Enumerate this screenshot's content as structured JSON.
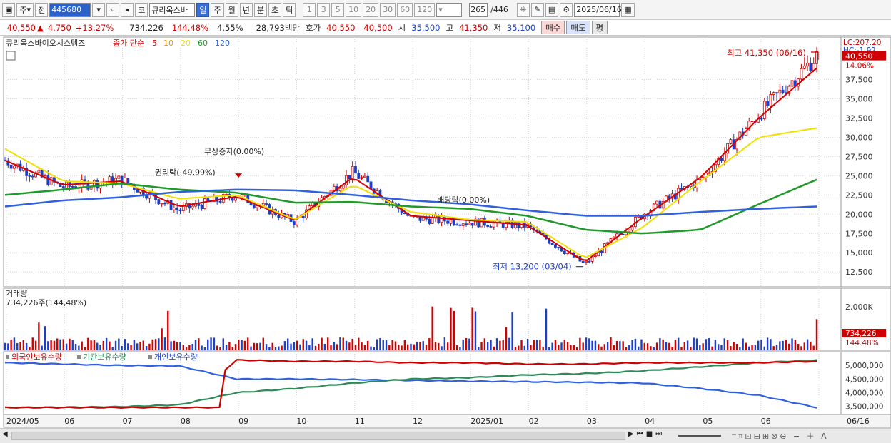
{
  "toolbar": {
    "period_selector": "주",
    "prev_label": "전",
    "stock_code": "445680",
    "code_label": "코",
    "stock_name": "큐리옥스바",
    "active_period": "일",
    "periods": [
      "주",
      "월",
      "년",
      "분",
      "초",
      "틱"
    ],
    "intervals": [
      "1",
      "3",
      "5",
      "10",
      "20",
      "30",
      "60",
      "120"
    ],
    "count_display": "265",
    "count_total": "/446",
    "date": "2025/06/16"
  },
  "quote": {
    "price": "40,550",
    "change_arrow": "▲",
    "change": "4,750",
    "change_pct": "+13.27%",
    "volume": "734,226",
    "volume_ratio": "144.48%",
    "turnover_rate": "4.55%",
    "amount": "28,793백만",
    "ask_label": "호가",
    "ask": "40,550",
    "bid": "40,500",
    "open_label": "시",
    "open": "35,500",
    "high_label": "고",
    "high": "41,350",
    "low_label": "저",
    "low": "35,100",
    "buy_label": "매수",
    "sell_label": "매도",
    "eval_label": "평"
  },
  "price_panel": {
    "stock_label": "큐리옥스바이오시스템즈",
    "indicator_label": "종가 단순",
    "ma_periods": [
      "5",
      "10",
      "20",
      "60",
      "120"
    ],
    "ma_colors": [
      "#d40000",
      "#f08c00",
      "#f0e000",
      "#1e9a2a",
      "#3060e0"
    ],
    "lc_label": "LC:207.20",
    "hc_label": "HC:-1.92",
    "last_price_tag": "40,550",
    "last_pct_tag": "14.06%",
    "y_ticks": [
      "37,500",
      "35,000",
      "32,500",
      "30,000",
      "27,500",
      "25,000",
      "22,500",
      "20,000",
      "17,500",
      "15,000",
      "12,500"
    ],
    "annotations": {
      "high": "최고 41,350 (06/16)",
      "low": "최저 13,200 (03/04)",
      "rights": "권리락(-49,99%)",
      "bonus": "무상증자(0.00%)",
      "dividend": "배당락(0.00%)"
    }
  },
  "volume_panel": {
    "title": "거래량",
    "value_text": "734,226주(144,48%)",
    "y_tick": "2,000K",
    "last_tag": "734,226",
    "last_pct_tag": "144.48%"
  },
  "holding_panel": {
    "series_labels": [
      "외국인보유수량",
      "기관보유수량",
      "개인보유수량"
    ],
    "series_colors": [
      "#1d3fc6",
      "#2e8b57",
      "#d10000"
    ],
    "y_ticks": [
      "5,000,000",
      "4,500,000",
      "4,000,000",
      "3,500,000"
    ]
  },
  "x_axis": {
    "labels": [
      "2024/05",
      "06",
      "07",
      "08",
      "09",
      "10",
      "11",
      "12",
      "2025/01",
      "02",
      "03",
      "04",
      "05",
      "06",
      "06/16"
    ]
  },
  "chart_data": {
    "type": "line",
    "title": "큐리옥스바이오시스템즈",
    "x": [
      "2024/05",
      "06",
      "07",
      "08",
      "09",
      "10",
      "11",
      "12",
      "2025/01",
      "02",
      "03",
      "04",
      "05",
      "06",
      "06/16"
    ],
    "ylim": [
      11500,
      41350
    ],
    "series": [
      {
        "name": "종가",
        "values": [
          27000,
          23500,
          24500,
          20500,
          22500,
          19000,
          25500,
          19500,
          19000,
          18500,
          13500,
          20000,
          24500,
          33000,
          40550
        ]
      },
      {
        "name": "5",
        "values": [
          27000,
          23800,
          24300,
          21000,
          22300,
          19200,
          24800,
          19800,
          19200,
          18600,
          13800,
          19600,
          24800,
          32500,
          39000
        ]
      },
      {
        "name": "20",
        "values": [
          28500,
          24300,
          24000,
          22000,
          22500,
          19300,
          23800,
          20300,
          19300,
          19000,
          14300,
          18300,
          24300,
          30000,
          31200
        ]
      },
      {
        "name": "60",
        "values": [
          22500,
          23200,
          24000,
          23200,
          22800,
          21500,
          21600,
          21000,
          20700,
          19800,
          18000,
          17500,
          18000,
          21300,
          24500
        ]
      },
      {
        "name": "120",
        "values": [
          21000,
          21800,
          22200,
          22900,
          23200,
          23100,
          22500,
          21800,
          21300,
          20500,
          19800,
          19800,
          20300,
          20700,
          21000
        ]
      }
    ],
    "volume_pct_max_marker": "2,000K",
    "holdings": [
      {
        "name": "외국인보유수량",
        "values": [
          5100000,
          5050000,
          5000000,
          4980000,
          4500000,
          4500000,
          4480000,
          4450000,
          4420000,
          4400000,
          4380000,
          4350000,
          4150000,
          3900000,
          3450000
        ]
      },
      {
        "name": "기관보유수량",
        "values": [
          3450000,
          3460000,
          3480000,
          3550000,
          4000000,
          4150000,
          4350000,
          4500000,
          4550000,
          4650000,
          4700000,
          4800000,
          4950000,
          5100000,
          5200000
        ]
      },
      {
        "name": "개인보유수량",
        "values": [
          3450000,
          3450000,
          3450000,
          3450000,
          5200000,
          5150000,
          5150000,
          5100000,
          5100000,
          5050000,
          5050000,
          5100000,
          5100000,
          5100000,
          5150000
        ]
      }
    ]
  }
}
